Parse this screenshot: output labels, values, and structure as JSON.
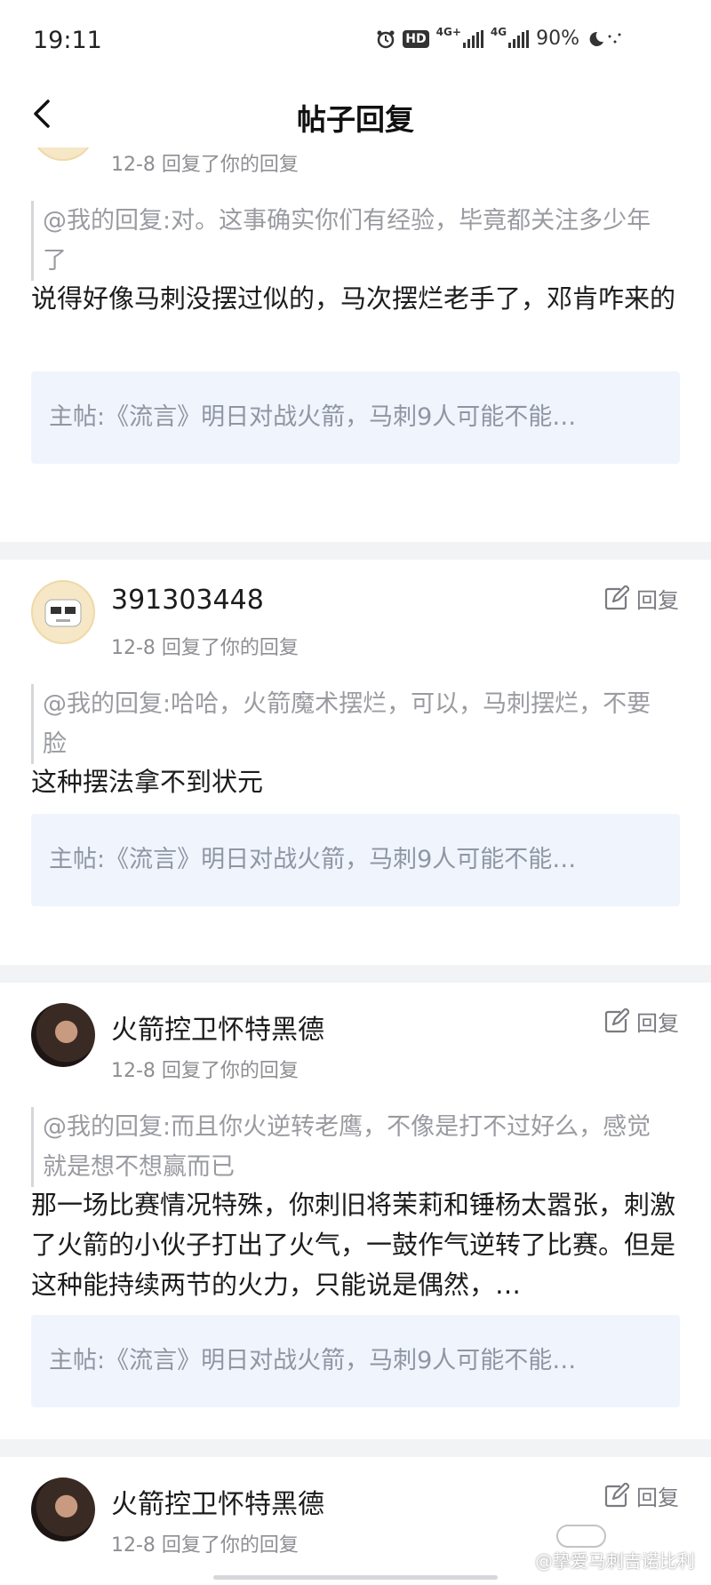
{
  "status": {
    "time": "19:11",
    "battery": "90%",
    "net1": "4G+",
    "net2": "4G",
    "hd": "HD",
    "icons": [
      "alarm-icon",
      "hd-icon",
      "signal-icon",
      "signal-icon",
      "night-mode-icon"
    ]
  },
  "nav": {
    "title": "帖子回复",
    "back_icon": "chevron-left-icon"
  },
  "reply_label": "回复",
  "cards": [
    {
      "avatar": "robot-avatar",
      "meta": "12-8 回复了你的回复",
      "quote": "@我的回复:对。这事确实你们有经验，毕竟都关注多少年了",
      "body": "说得好像马刺没摆过似的，马次摆烂老手了，邓肯咋来的",
      "main_post": "主帖:《流言》明日对战火箭，马刺9人可能不能…"
    },
    {
      "avatar": "robot-avatar",
      "username": "391303448",
      "meta": "12-8 回复了你的回复",
      "quote": "@我的回复:哈哈，火箭魔术摆烂，可以，马刺摆烂，不要脸",
      "body": "这种摆法拿不到状元",
      "main_post": "主帖:《流言》明日对战火箭，马刺9人可能不能…"
    },
    {
      "avatar": "photo-avatar",
      "username": "火箭控卫怀特黑德",
      "meta": "12-8 回复了你的回复",
      "quote": "@我的回复:而且你火逆转老鹰，不像是打不过好么，感觉就是想不想赢而已",
      "body": "那一场比赛情况特殊，你刺旧将茉莉和锤杨太嚣张，刺激了火箭的小伙子打出了火气，一鼓作气逆转了比赛。但是这种能持续两节的火力，只能说是偶然，…",
      "main_post": "主帖:《流言》明日对战火箭，马刺9人可能不能…"
    },
    {
      "avatar": "photo-avatar",
      "username": "火箭控卫怀特黑德",
      "meta": "12-8 回复了你的回复"
    }
  ],
  "watermark": "@挚爱马刺吉诺比利",
  "theme": {
    "accent_bg": "#f0f4fd",
    "separator": "#f2f3f5",
    "muted_text": "#8e8e93"
  }
}
